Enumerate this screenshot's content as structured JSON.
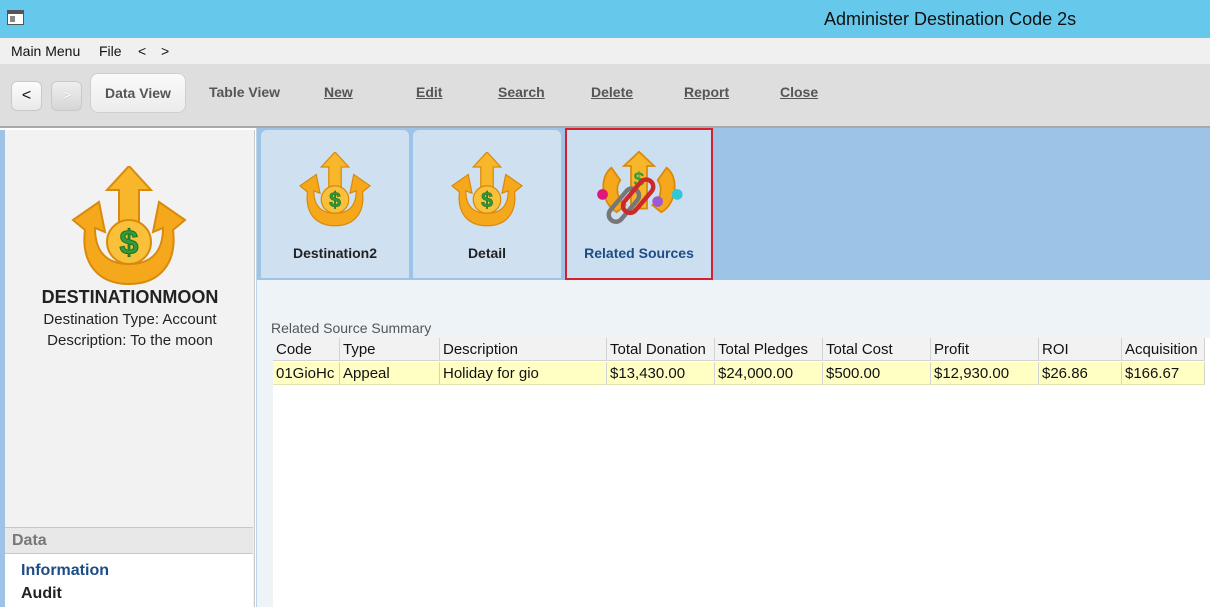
{
  "window": {
    "title": "Administer Destination Code 2s"
  },
  "menu": {
    "items": [
      "Main Menu",
      "File",
      "<",
      ">"
    ]
  },
  "toolbar": {
    "back_label": "<",
    "forward_label": ">",
    "data_view": "Data View",
    "table_view": "Table View",
    "new": "New",
    "edit": "Edit",
    "search": "Search",
    "delete": "Delete",
    "report": "Report",
    "close": "Close"
  },
  "left": {
    "icon": "dollar-arrows-icon",
    "name": "DESTINATIONMOON",
    "type_line": "Destination Type: Account",
    "description_line": "Description: To the moon",
    "section_header": "Data",
    "links": [
      "Information",
      "Audit"
    ]
  },
  "tabs": [
    {
      "label": "Destination2",
      "icon": "dollar-arrows-icon",
      "selected": false
    },
    {
      "label": "Detail",
      "icon": "dollar-arrows-icon",
      "selected": false
    },
    {
      "label": "Related Sources",
      "icon": "dollar-link-icon",
      "selected": true
    }
  ],
  "summary": {
    "label": "Related Source Summary",
    "columns": [
      "Code",
      "Type",
      "Description",
      "Total Donation",
      "Total Pledges",
      "Total Cost",
      "Profit",
      "ROI",
      "Acquisition"
    ],
    "rows": [
      [
        "01GioHc",
        "Appeal",
        "Holiday for gio",
        "$13,430.00",
        "$24,000.00",
        "$500.00",
        "$12,930.00",
        "$26.86",
        "$166.67"
      ]
    ]
  },
  "colors": {
    "titlebar": "#66c8eb",
    "tab_strip": "#9dc3e6",
    "selected_border": "#d51f2f",
    "row_highlight": "#ffffc4",
    "link": "#1e4c86"
  }
}
